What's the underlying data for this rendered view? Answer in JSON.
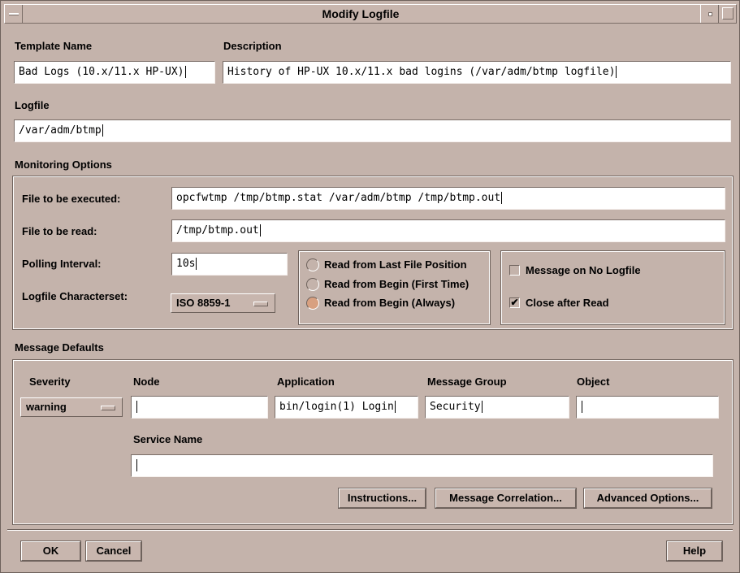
{
  "window": {
    "title": "Modify Logfile"
  },
  "template": {
    "name_label": "Template Name",
    "name_value": "Bad Logs (10.x/11.x HP-UX)",
    "desc_label": "Description",
    "desc_value": "History of HP-UX 10.x/11.x bad logins (/var/adm/btmp logfile)"
  },
  "logfile": {
    "label": "Logfile",
    "value": "/var/adm/btmp"
  },
  "monitoring": {
    "section_label": "Monitoring Options",
    "exec_label": "File to be executed:",
    "exec_value": "opcfwtmp /tmp/btmp.stat /var/adm/btmp  /tmp/btmp.out",
    "read_label": "File to be read:",
    "read_value": "/tmp/btmp.out",
    "polling_label": "Polling Interval:",
    "polling_value": "10s",
    "charset_label": "Logfile Characterset:",
    "charset_value": "ISO 8859-1",
    "radio": [
      {
        "label": "Read from Last File Position",
        "selected": false
      },
      {
        "label": "Read from Begin (First Time)",
        "selected": false
      },
      {
        "label": "Read from Begin (Always)",
        "selected": true
      }
    ],
    "checks": [
      {
        "label": "Message on No Logfile",
        "checked": false
      },
      {
        "label": "Close after Read",
        "checked": true
      }
    ]
  },
  "defaults": {
    "section_label": "Message Defaults",
    "severity_label": "Severity",
    "severity_value": "warning",
    "node_label": "Node",
    "node_value": "",
    "application_label": "Application",
    "application_value": "bin/login(1) Login",
    "group_label": "Message Group",
    "group_value": "Security",
    "object_label": "Object",
    "object_value": "",
    "service_label": "Service Name",
    "service_value": "",
    "instructions_button": "Instructions...",
    "correlation_button": "Message Correlation...",
    "advanced_button": "Advanced Options..."
  },
  "footer": {
    "ok": "OK",
    "cancel": "Cancel",
    "help": "Help"
  },
  "colors": {
    "background": "#c4b3ab",
    "selected_radio": "#d8a080"
  }
}
